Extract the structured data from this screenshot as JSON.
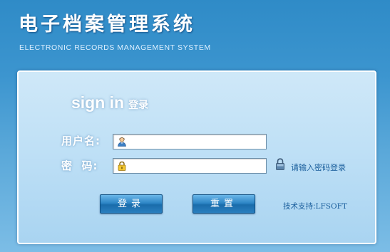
{
  "header": {
    "title": "电子档案管理系统",
    "subtitle": "ELECTRONIC RECORDS MANAGEMENT SYSTEM"
  },
  "login": {
    "heading_en": "sign in",
    "heading_cn": "登录",
    "username": {
      "label": "用户名:",
      "value": "",
      "icon": "user-icon"
    },
    "password": {
      "label": "密  码:",
      "value": "",
      "icon": "lock-icon"
    },
    "hint": {
      "icon": "lock-icon",
      "text": "请输入密码登录"
    },
    "buttons": {
      "login": "登录",
      "reset": "重置"
    },
    "support": {
      "label": "技术支持:",
      "value": "LFSOFT"
    }
  },
  "colors": {
    "background": "#3c95cf",
    "panel": "#bfe0f6",
    "button": "#2e86c6",
    "link_text": "#1a5e9c"
  }
}
